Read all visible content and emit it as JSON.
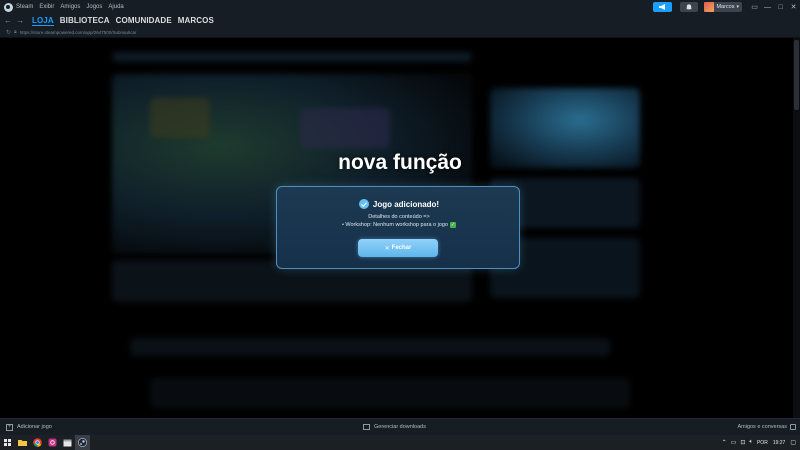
{
  "menubar": {
    "app_name": "Steam",
    "items": [
      "Exibir",
      "Amigos",
      "Jogos",
      "Ajuda"
    ],
    "user_name": "Marcos"
  },
  "nav": {
    "tabs": [
      {
        "label": "LOJA",
        "active": true
      },
      {
        "label": "BIBLIOTECA",
        "active": false
      },
      {
        "label": "COMUNIDADE",
        "active": false
      },
      {
        "label": "MARCOS",
        "active": false
      }
    ],
    "url": "https://store.steampowered.com/app/2647500/Subnautica/"
  },
  "main": {
    "headline": "nova função"
  },
  "modal": {
    "title": "Jogo adicionado!",
    "line1": "Detalhes do conteúdo =>",
    "line2": "• Workshop: Nenhum workshop para o jogo",
    "close_label": "Fechar",
    "accent": "#66c0f4"
  },
  "bottombar": {
    "add_game": "Adicionar jogo",
    "downloads": "Gerenciar downloads",
    "friends": "Amigos e conversas"
  },
  "taskbar": {
    "language": "POR",
    "time": "19:27"
  },
  "colors": {
    "steam_bar": "#171d25",
    "active_tab": "#1a9fff",
    "modal_bg": "#1d3a52"
  }
}
